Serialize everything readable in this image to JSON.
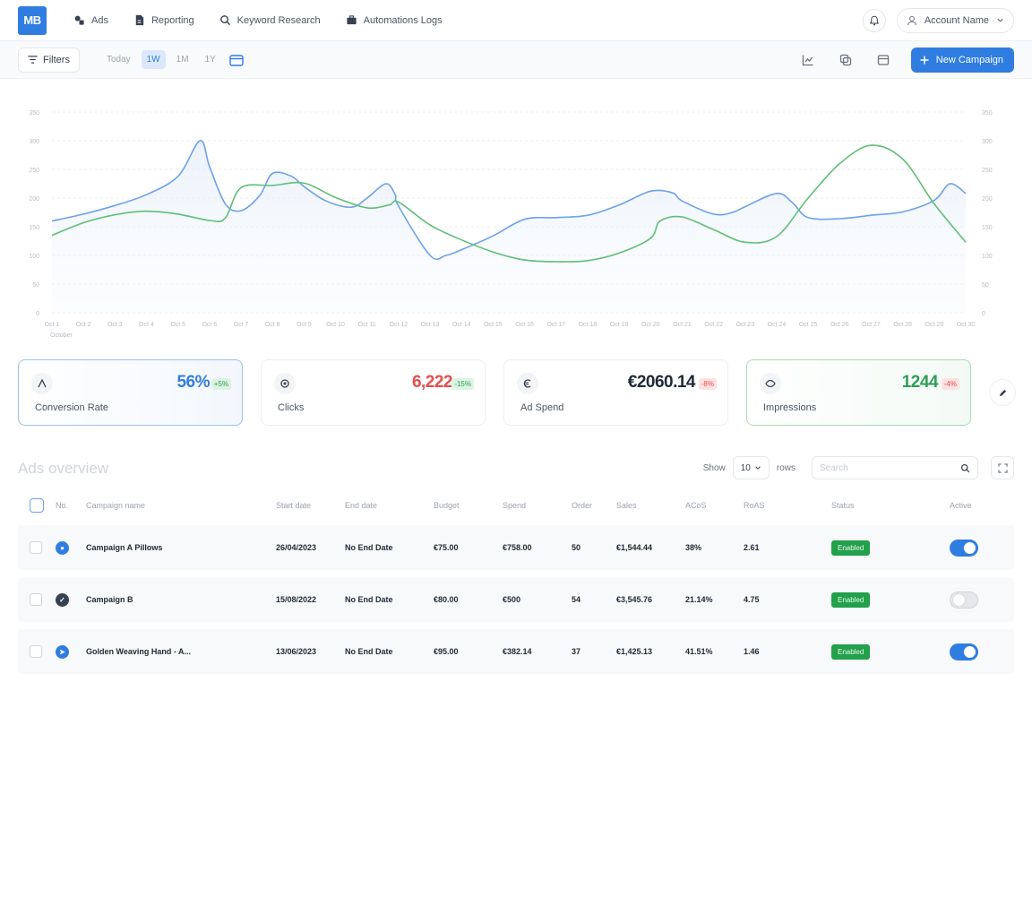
{
  "nav": {
    "logo_text": "MB",
    "links": [
      "Ads",
      "Reporting",
      "Keyword Research",
      "Automations Logs"
    ],
    "account_label": "Account Name"
  },
  "toolbar": {
    "filters_label": "Filters",
    "ranges": [
      "Today",
      "1W",
      "1M",
      "1Y"
    ],
    "active_range": "1W",
    "new_campaign_label": "New Campaign"
  },
  "chart_data": {
    "type": "area",
    "y_left_ticks": [
      "0",
      "50",
      "100",
      "150",
      "200",
      "250",
      "300",
      "350"
    ],
    "y_right_ticks": [
      "0",
      "50",
      "100",
      "150",
      "200",
      "250",
      "300",
      "350"
    ],
    "x_ticks": [
      "Oct 1",
      "Oct 2",
      "Oct 3",
      "Oct 4",
      "Oct 5",
      "Oct 6",
      "Oct 7",
      "Oct 8",
      "Oct 9",
      "Oct 10",
      "Oct 11",
      "Oct 12",
      "Oct 13",
      "Oct 14",
      "Oct 15",
      "Oct 16",
      "Oct 17",
      "Oct 18",
      "Oct 19",
      "Oct 20",
      "Oct 21",
      "Oct 22",
      "Oct 23",
      "Oct 24",
      "Oct 25",
      "Oct 26",
      "Oct 27",
      "Oct 28",
      "Oct 29",
      "Oct 30"
    ],
    "x_label": "October",
    "ylim": [
      0,
      350
    ],
    "grid": true,
    "series": [
      {
        "color": "#6ea1ea",
        "points": [
          [
            1,
            160
          ],
          [
            2,
            172
          ],
          [
            3,
            187
          ],
          [
            4,
            206
          ],
          [
            5,
            238
          ],
          [
            5.7,
            300
          ],
          [
            6,
            255
          ],
          [
            6.5,
            190
          ],
          [
            7,
            178
          ],
          [
            7.6,
            205
          ],
          [
            8,
            243
          ],
          [
            8.6,
            238
          ],
          [
            9,
            220
          ],
          [
            9.7,
            195
          ],
          [
            10.5,
            184
          ],
          [
            11,
            200
          ],
          [
            11.6,
            225
          ],
          [
            11.9,
            205
          ],
          [
            12,
            186
          ],
          [
            13,
            100
          ],
          [
            13.5,
            100
          ],
          [
            14,
            110
          ],
          [
            15,
            134
          ],
          [
            16,
            163
          ],
          [
            17,
            166
          ],
          [
            18,
            170
          ],
          [
            19,
            188
          ],
          [
            20,
            212
          ],
          [
            20.7,
            209
          ],
          [
            21,
            195
          ],
          [
            22,
            172
          ],
          [
            22.6,
            175
          ],
          [
            23,
            185
          ],
          [
            24,
            208
          ],
          [
            24.5,
            192
          ],
          [
            25,
            166
          ],
          [
            26,
            164
          ],
          [
            27,
            170
          ],
          [
            28,
            176
          ],
          [
            29,
            196
          ],
          [
            29.5,
            225
          ],
          [
            30,
            208
          ]
        ]
      },
      {
        "color": "#5fbf75",
        "points": [
          [
            1,
            135
          ],
          [
            2,
            157
          ],
          [
            3,
            171
          ],
          [
            4,
            177
          ],
          [
            5,
            172
          ],
          [
            6,
            161
          ],
          [
            6.5,
            165
          ],
          [
            7,
            218
          ],
          [
            8,
            222
          ],
          [
            9,
            226
          ],
          [
            10,
            201
          ],
          [
            11,
            183
          ],
          [
            11.7,
            188
          ],
          [
            12,
            193
          ],
          [
            13,
            153
          ],
          [
            14,
            127
          ],
          [
            15,
            106
          ],
          [
            16,
            92
          ],
          [
            17,
            89
          ],
          [
            18,
            91
          ],
          [
            19,
            104
          ],
          [
            20,
            130
          ],
          [
            20.3,
            160
          ],
          [
            21,
            167
          ],
          [
            22,
            145
          ],
          [
            23,
            123
          ],
          [
            24,
            133
          ],
          [
            25,
            200
          ],
          [
            26,
            260
          ],
          [
            27,
            292
          ],
          [
            28,
            268
          ],
          [
            29,
            190
          ],
          [
            30,
            123
          ]
        ]
      }
    ]
  },
  "kpis": [
    {
      "label": "Conversion Rate",
      "value": "56%",
      "badge": "+5%",
      "icon": "conversion-icon",
      "color": "#2f7de1",
      "style": "blue"
    },
    {
      "label": "Clicks",
      "value": "6,222",
      "badge": "-15%",
      "icon": "click-icon",
      "color": "#ea4c4c",
      "style": "plain"
    },
    {
      "label": "Ad Spend",
      "value": "€2060.14",
      "badge": "-8%",
      "icon": "spend-icon",
      "color": "#1f2937",
      "style": "plain"
    },
    {
      "label": "Impressions",
      "value": "1244",
      "badge": "-4%",
      "icon": "impressions-icon",
      "color": "#2e9d55",
      "style": "green"
    }
  ],
  "ads": {
    "title": "Ads overview",
    "show_label": "Show",
    "show_value": "10",
    "show_suffix": "rows",
    "search_placeholder": "Search",
    "columns": [
      "No.",
      "Campaign name",
      "Start date",
      "End date",
      "Budget",
      "Spend",
      "Order",
      "Sales",
      "ACoS",
      "RoAS",
      "Status",
      "Active"
    ],
    "rows": [
      {
        "no_icon": "blue",
        "name": "Campaign A Pillows",
        "start": "26/04/2023",
        "end": "No End Date",
        "budget": "€75.00",
        "spend": "€758.00",
        "order": "50",
        "sales": "€1,544.44",
        "acos": "38%",
        "roas": "2.61",
        "status": "Enabled",
        "active": true
      },
      {
        "no_icon": "dark",
        "name": "Campaign B",
        "start": "15/08/2022",
        "end": "No End Date",
        "budget": "€80.00",
        "spend": "€500",
        "order": "54",
        "sales": "€3,545.76",
        "acos": "21.14%",
        "roas": "4.75",
        "status": "Enabled",
        "active": false
      },
      {
        "no_icon": "blue",
        "name": "Golden Weaving Hand - A...",
        "start": "13/06/2023",
        "end": "No End Date",
        "budget": "€95.00",
        "spend": "€382.14",
        "order": "37",
        "sales": "€1,425.13",
        "acos": "41.51%",
        "roas": "1.46",
        "status": "Enabled",
        "active": true
      }
    ]
  }
}
